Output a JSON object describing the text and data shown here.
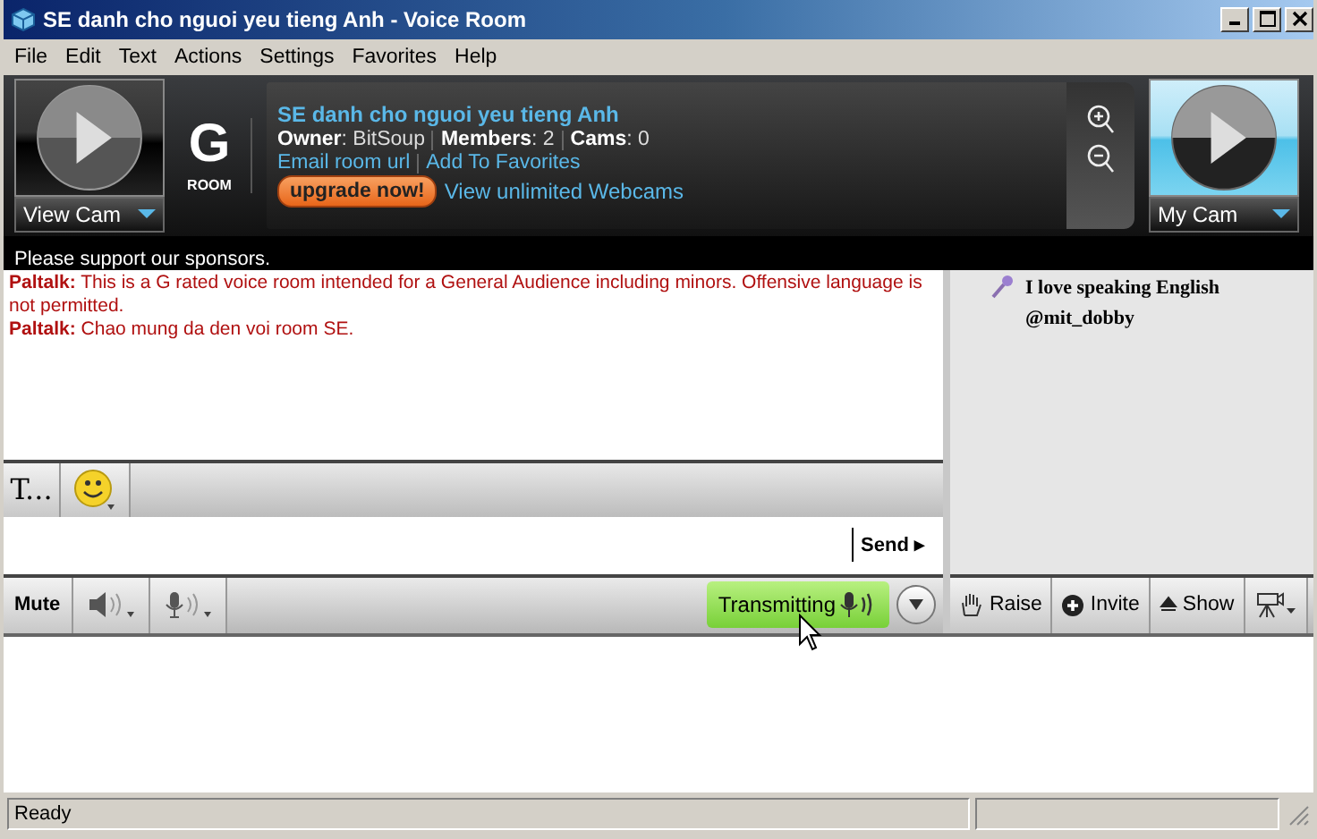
{
  "window": {
    "title": "SE danh cho nguoi yeu tieng Anh - Voice Room"
  },
  "menu": [
    "File",
    "Edit",
    "Text",
    "Actions",
    "Settings",
    "Favorites",
    "Help"
  ],
  "header": {
    "view_cam": "View Cam",
    "rating": "G",
    "rating_label": "ROOM",
    "room_name": "SE danh cho nguoi yeu tieng Anh",
    "owner": "**Owner**: BitSoup",
    "members": "**Members**: 2",
    "cams": "**Cams**: 0",
    "email_link": "Email room url",
    "favorites_link": "Add To Favorites",
    "upgrade_button": "upgrade now!",
    "webcams_link": "View unlimited Webcams",
    "my_cam": "My Cam"
  },
  "sponsor_text": "Please support our sponsors.",
  "messages": [
    {
      "sender": "Paltalk:",
      "text": "This is a G rated voice room intended for a General Audience including minors.  Offensive language is not permitted."
    },
    {
      "sender": "Paltalk:",
      "text": "Chao mung da den voi room SE."
    }
  ],
  "format_toolbar": {
    "font_button": "T..."
  },
  "input": {
    "send_button": "Send ▸"
  },
  "voice_toolbar": {
    "mute_button": "Mute",
    "transmit_button": "Transmitting"
  },
  "users": [
    {
      "lines": [
        "I love speaking English",
        "@mit_dobby"
      ],
      "speaking": true
    }
  ],
  "user_toolbar": {
    "raise_button": "Raise",
    "invite_button": "Invite",
    "show_button": "Show"
  },
  "status_bar": {
    "text": "Ready"
  }
}
